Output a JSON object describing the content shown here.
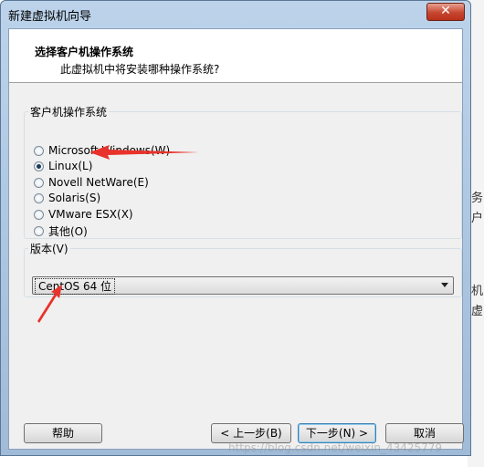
{
  "window": {
    "title": "新建虚拟机向导",
    "close_glyph": "✕"
  },
  "header": {
    "title": "选择客户机操作系统",
    "subtitle": "此虚拟机中将安装哪种操作系统?"
  },
  "guest_os": {
    "group_label": "客户机操作系统",
    "options": [
      {
        "label": "Microsoft Windows(W)",
        "checked": false
      },
      {
        "label": "Linux(L)",
        "checked": true
      },
      {
        "label": "Novell NetWare(E)",
        "checked": false
      },
      {
        "label": "Solaris(S)",
        "checked": false
      },
      {
        "label": "VMware ESX(X)",
        "checked": false
      },
      {
        "label": "其他(O)",
        "checked": false
      }
    ]
  },
  "version": {
    "group_label": "版本(V)",
    "selected": "CentOS 64 位"
  },
  "buttons": {
    "help": "帮助",
    "back": "< 上一步(B)",
    "next": "下一步(N) >",
    "cancel": "取消"
  },
  "background_app": {
    "glyphs": [
      "务",
      "户",
      "机",
      "虚"
    ]
  },
  "watermark": "https://blog.csdn.net/weixin_43425779",
  "annotation_color": "#e8322b"
}
